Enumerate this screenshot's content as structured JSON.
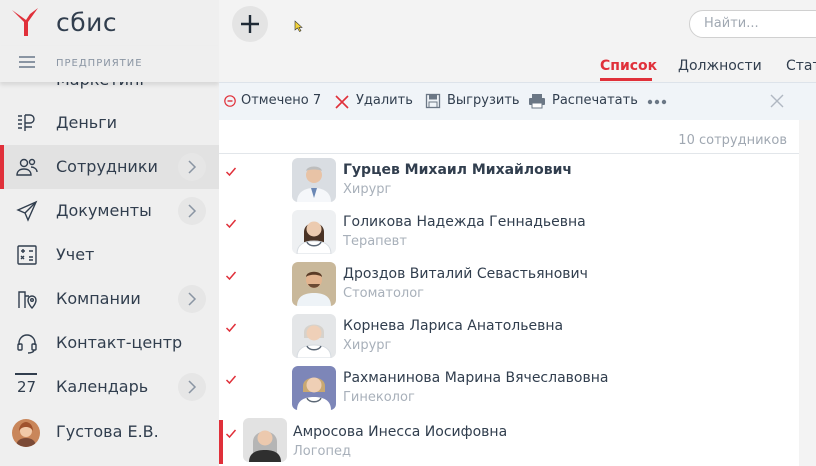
{
  "app": {
    "logo_text": "сбис",
    "company_label": "ПРЕДПРИЯТИЕ",
    "hidden_menu_text": "Маркетинг"
  },
  "sidebar": {
    "items": [
      {
        "label": "Деньги",
        "icon": "money-icon",
        "chevron": false,
        "active": false
      },
      {
        "label": "Сотрудники",
        "icon": "people-icon",
        "chevron": true,
        "active": true
      },
      {
        "label": "Документы",
        "icon": "paper-plane-icon",
        "chevron": true,
        "active": false
      },
      {
        "label": "Учет",
        "icon": "calculator-icon",
        "chevron": false,
        "active": false
      },
      {
        "label": "Компании",
        "icon": "building-pin-icon",
        "chevron": true,
        "active": false
      },
      {
        "label": "Контакт-центр",
        "icon": "headset-icon",
        "chevron": false,
        "active": false
      },
      {
        "label": "Календарь",
        "icon": "calendar-icon",
        "chevron": true,
        "active": false,
        "day": "27"
      },
      {
        "label": "Густова Е.В.",
        "icon": "user-avatar",
        "chevron": false,
        "active": false
      }
    ]
  },
  "topbar": {
    "search_placeholder": "Найти..."
  },
  "tabs": [
    {
      "label": "Список",
      "active": true
    },
    {
      "label": "Должности",
      "active": false
    },
    {
      "label": "Стат",
      "active": false
    }
  ],
  "toolbar": {
    "marked_label": "Отмечено 7",
    "delete_label": "Удалить",
    "export_label": "Выгрузить",
    "print_label": "Распечатать"
  },
  "list": {
    "count_text": "10 сотрудников",
    "rows": [
      {
        "name": "Гурцев Михаил Михайлович",
        "role": "Хирург",
        "checked": true,
        "bold": true
      },
      {
        "name": "Голикова Надежда Геннадьевна",
        "role": "Терапевт",
        "checked": true,
        "bold": false
      },
      {
        "name": "Дроздов Виталий Севастьянович",
        "role": "Стоматолог",
        "checked": true,
        "bold": false
      },
      {
        "name": "Корнева Лариса Анатольевна",
        "role": "Хирург",
        "checked": true,
        "bold": false
      },
      {
        "name": "Рахманинова Марина Вячеславовна",
        "role": "Гинеколог",
        "checked": true,
        "bold": false
      },
      {
        "name": "Амросова Инесса Иосифовна",
        "role": "Логопед",
        "checked": true,
        "bold": false
      }
    ]
  },
  "colors": {
    "accent": "#e0303a",
    "text": "#313e4e",
    "muted": "#a8b0ba"
  }
}
